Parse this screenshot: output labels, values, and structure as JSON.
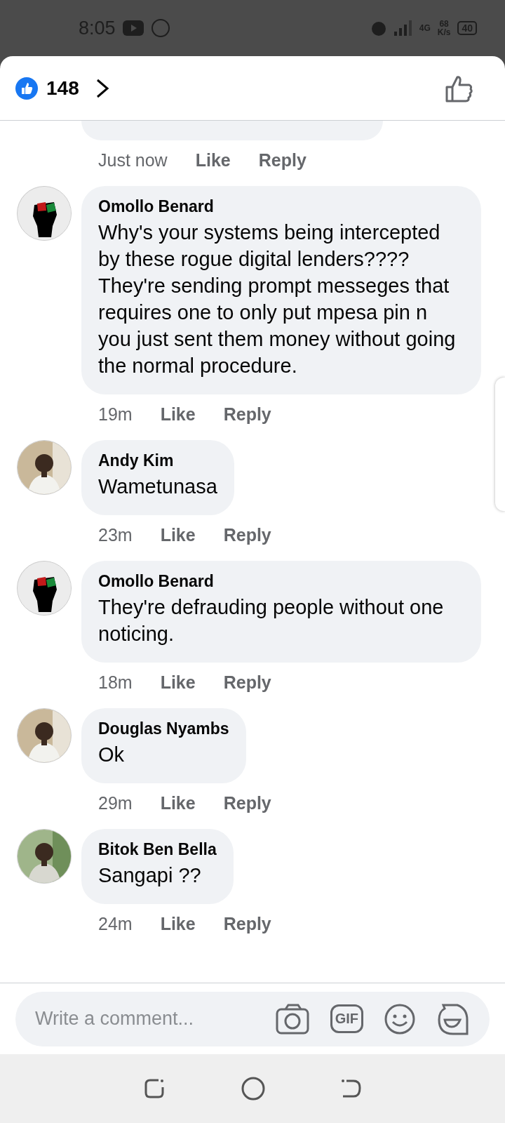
{
  "status_bar": {
    "time": "8:05",
    "speed_value": "68",
    "speed_unit": "K/s",
    "network": "4G",
    "battery": "40"
  },
  "header": {
    "reaction_count": "148"
  },
  "comments": [
    {
      "kind": "partial",
      "time": "Just now",
      "like": "Like",
      "reply": "Reply"
    },
    {
      "kind": "fist",
      "name": "Omollo Benard",
      "text": "Why's your systems being intercepted by these rogue digital lenders???? They're sending prompt messeges that requires one to only put mpesa pin n you just sent them money without going the normal procedure.",
      "time": "19m",
      "like": "Like",
      "reply": "Reply"
    },
    {
      "name": "Andy Kim",
      "text": "Wametunasa",
      "time": "23m",
      "like": "Like",
      "reply": "Reply"
    },
    {
      "kind": "fist",
      "name": "Omollo Benard",
      "text": "They're defrauding people without one noticing.",
      "time": "18m",
      "like": "Like",
      "reply": "Reply"
    },
    {
      "name": "Douglas Nyambs",
      "text": "Ok",
      "time": "29m",
      "like": "Like",
      "reply": "Reply"
    },
    {
      "name": "Bitok Ben Bella",
      "text": "Sangapi ??",
      "time": "24m",
      "like": "Like",
      "reply": "Reply"
    }
  ],
  "composer": {
    "placeholder": "Write a comment...",
    "gif": "GIF"
  }
}
